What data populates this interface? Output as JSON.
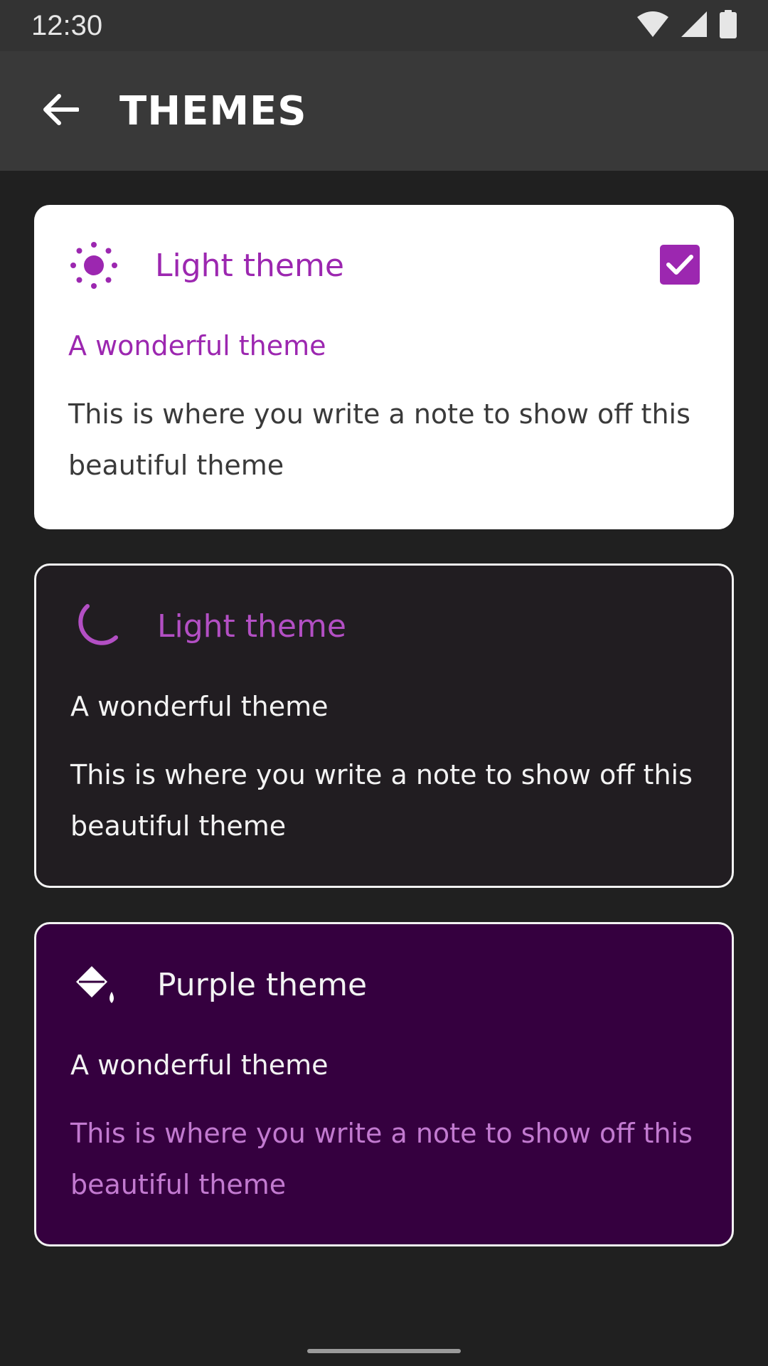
{
  "status_bar": {
    "time": "12:30"
  },
  "app_bar": {
    "title": "THEMES"
  },
  "themes": [
    {
      "title": "Light theme",
      "subtitle": "A wonderful theme",
      "body": "This is where you write a note to show off this beautiful theme",
      "icon": "sun-icon",
      "selected": true
    },
    {
      "title": "Light theme",
      "subtitle": "A wonderful theme",
      "body": "This is where you write a note to show off this beautiful theme",
      "icon": "moon-icon",
      "selected": false
    },
    {
      "title": "Purple theme",
      "subtitle": "A wonderful theme",
      "body": "This is where you write a note to show off this beautiful theme",
      "icon": "paint-bucket-icon",
      "selected": false
    }
  ],
  "colors": {
    "accent": "#9c27b0",
    "background": "#202020",
    "app_bar": "#393939",
    "purple_card": "#35003f"
  }
}
